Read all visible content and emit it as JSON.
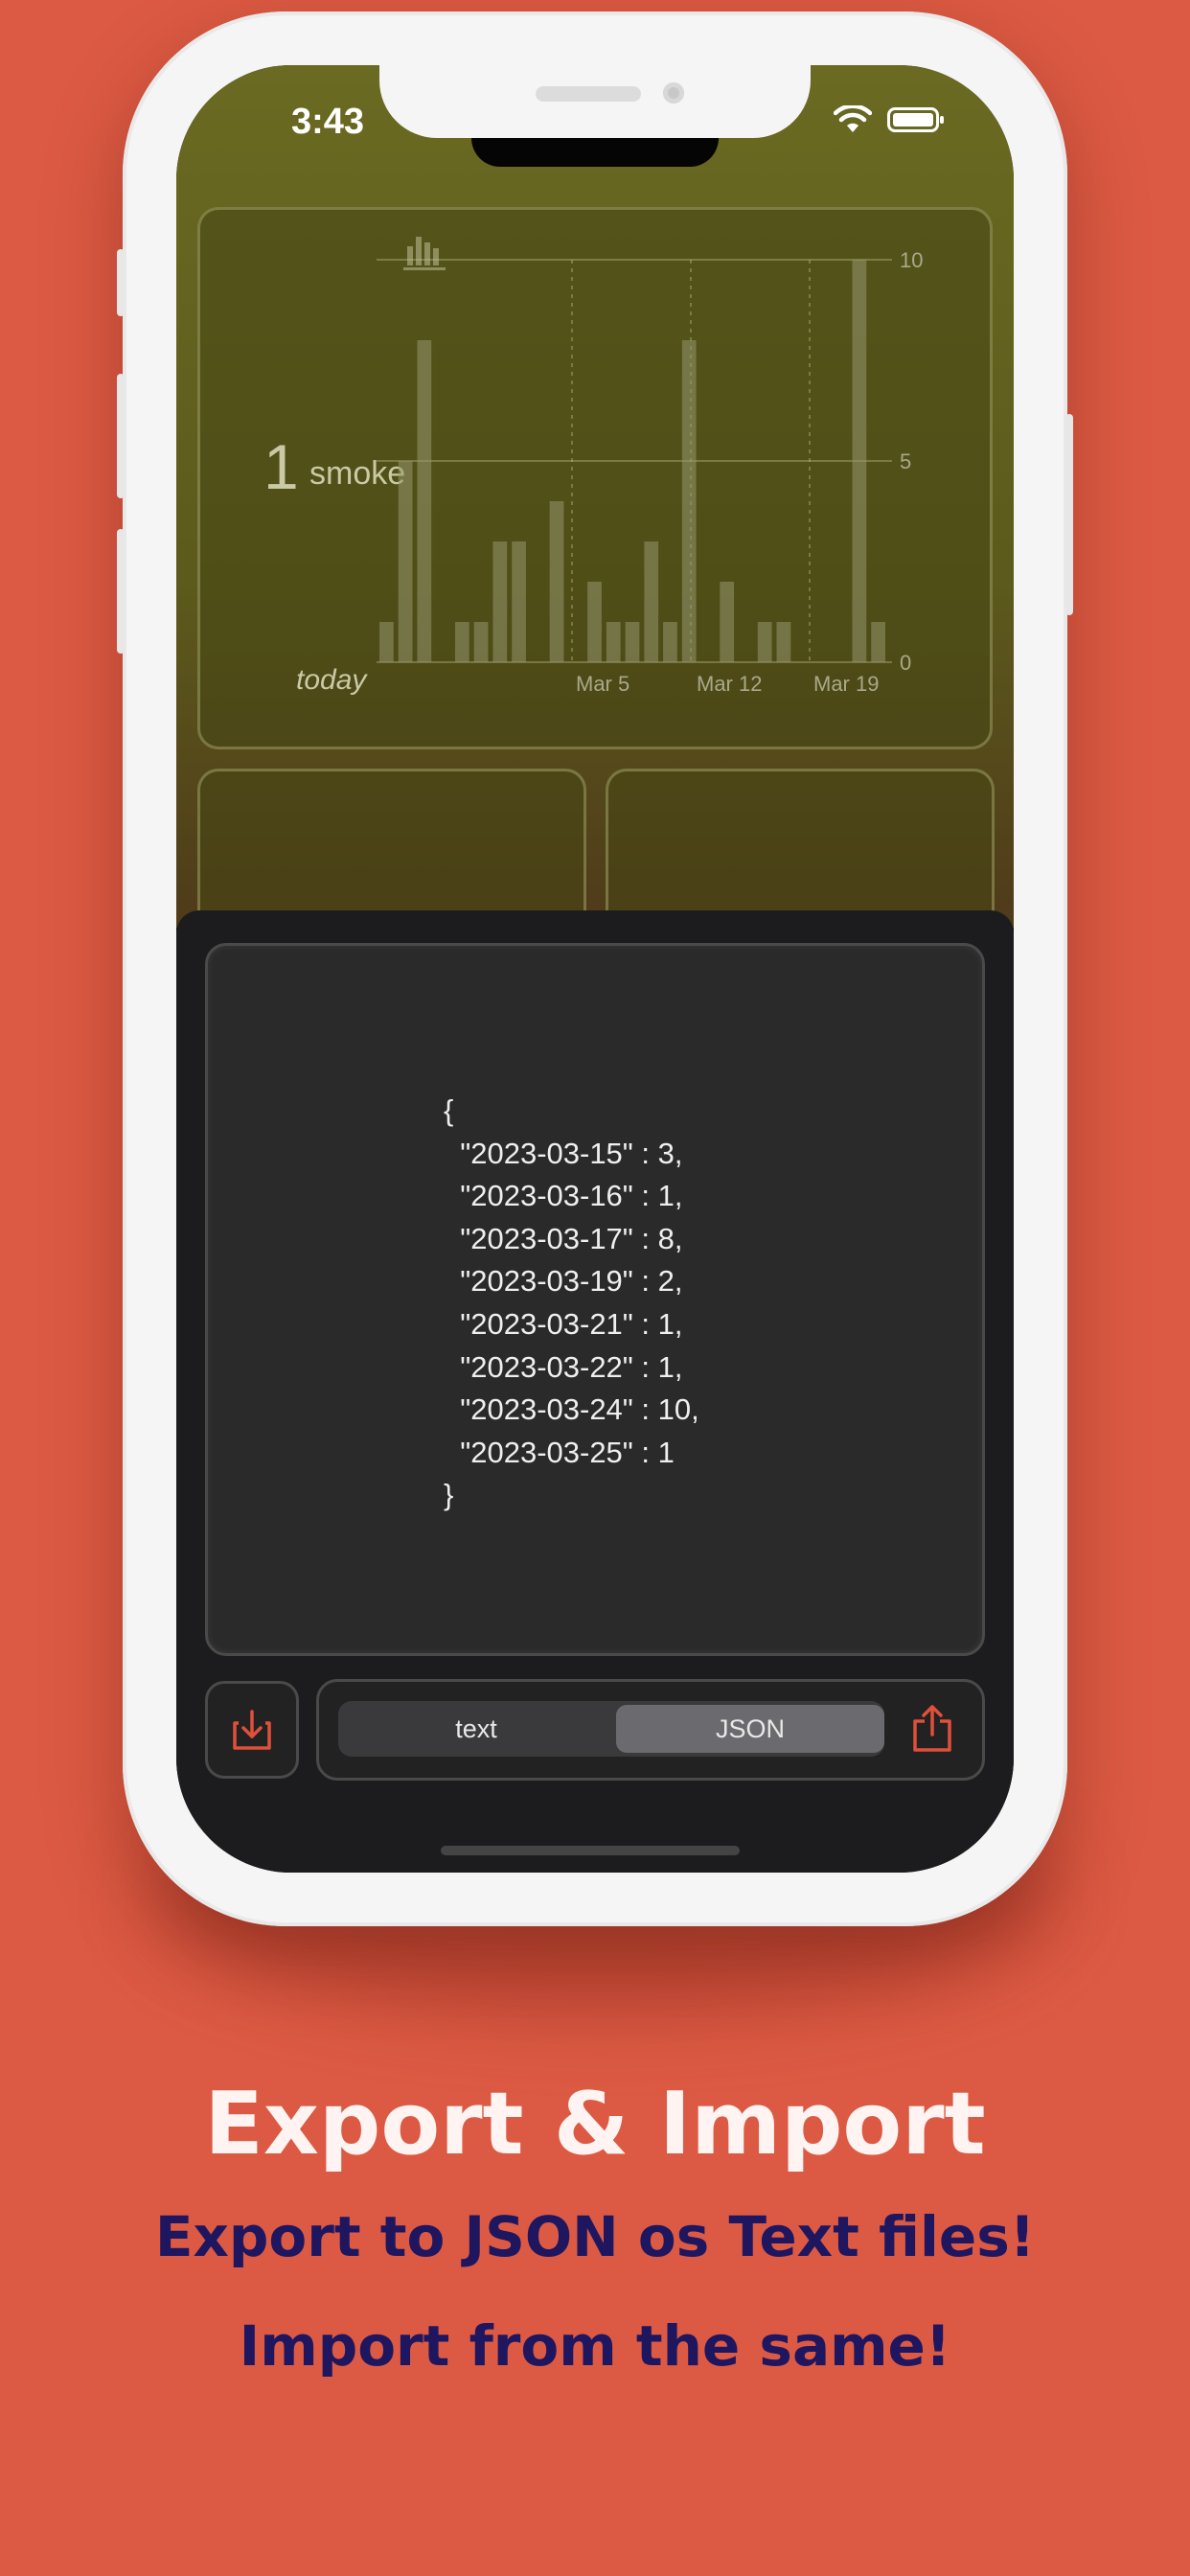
{
  "status_bar": {
    "time": "3:43"
  },
  "widget": {
    "count": "1",
    "unit": "smoke",
    "period": "today"
  },
  "chart_data": {
    "type": "bar",
    "x_tick_labels": [
      "Mar 5",
      "Mar 12",
      "Mar 19"
    ],
    "y_tick_labels": [
      "10",
      "5",
      "0"
    ],
    "ylim": [
      0,
      10
    ],
    "values": [
      1,
      5,
      8,
      0,
      1,
      1,
      3,
      3,
      0,
      4,
      0,
      2,
      1,
      1,
      3,
      1,
      8,
      0,
      2,
      0,
      1,
      1,
      0,
      0,
      0,
      10,
      1
    ],
    "grid": true
  },
  "export_sheet": {
    "json_lines": [
      "{",
      "  \"2023-03-15\" : 3,",
      "  \"2023-03-16\" : 1,",
      "  \"2023-03-17\" : 8,",
      "  \"2023-03-19\" : 2,",
      "  \"2023-03-21\" : 1,",
      "  \"2023-03-22\" : 1,",
      "  \"2023-03-24\" : 10,",
      "  \"2023-03-25\" : 1",
      "}"
    ],
    "format_options": [
      "text",
      "JSON"
    ],
    "selected_format": "JSON"
  },
  "promo": {
    "title": "Export & Import",
    "subtitle_1": "Export to JSON os Text files!",
    "subtitle_2": "Import from the same!"
  },
  "colors": {
    "background": "#dc5a43",
    "accent": "#e0503a",
    "promo_subtitle": "#1f1660"
  },
  "icons": [
    "chart-bar-icon",
    "wifi-icon",
    "battery-icon",
    "import-icon",
    "share-icon"
  ]
}
